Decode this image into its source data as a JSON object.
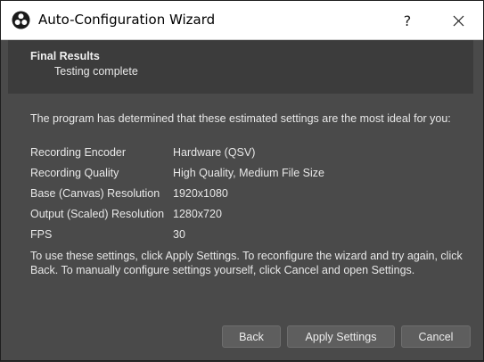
{
  "window": {
    "title": "Auto-Configuration Wizard",
    "help_label": "?",
    "close_label": "✕"
  },
  "header": {
    "title": "Final Results",
    "subtitle": "Testing complete"
  },
  "intro_text": "The program has determined that these estimated settings are the most ideal for you:",
  "settings": [
    {
      "label": "Recording Encoder",
      "value": "Hardware (QSV)"
    },
    {
      "label": "Recording Quality",
      "value": "High Quality, Medium File Size"
    },
    {
      "label": "Base (Canvas) Resolution",
      "value": "1920x1080"
    },
    {
      "label": "Output (Scaled) Resolution",
      "value": "1280x720"
    },
    {
      "label": "FPS",
      "value": "30"
    }
  ],
  "outro_text": "To use these settings, click Apply Settings.  To reconfigure the wizard and try again, click Back.  To manually configure settings yourself, click Cancel and open Settings.",
  "buttons": {
    "back": "Back",
    "apply": "Apply Settings",
    "cancel": "Cancel"
  }
}
